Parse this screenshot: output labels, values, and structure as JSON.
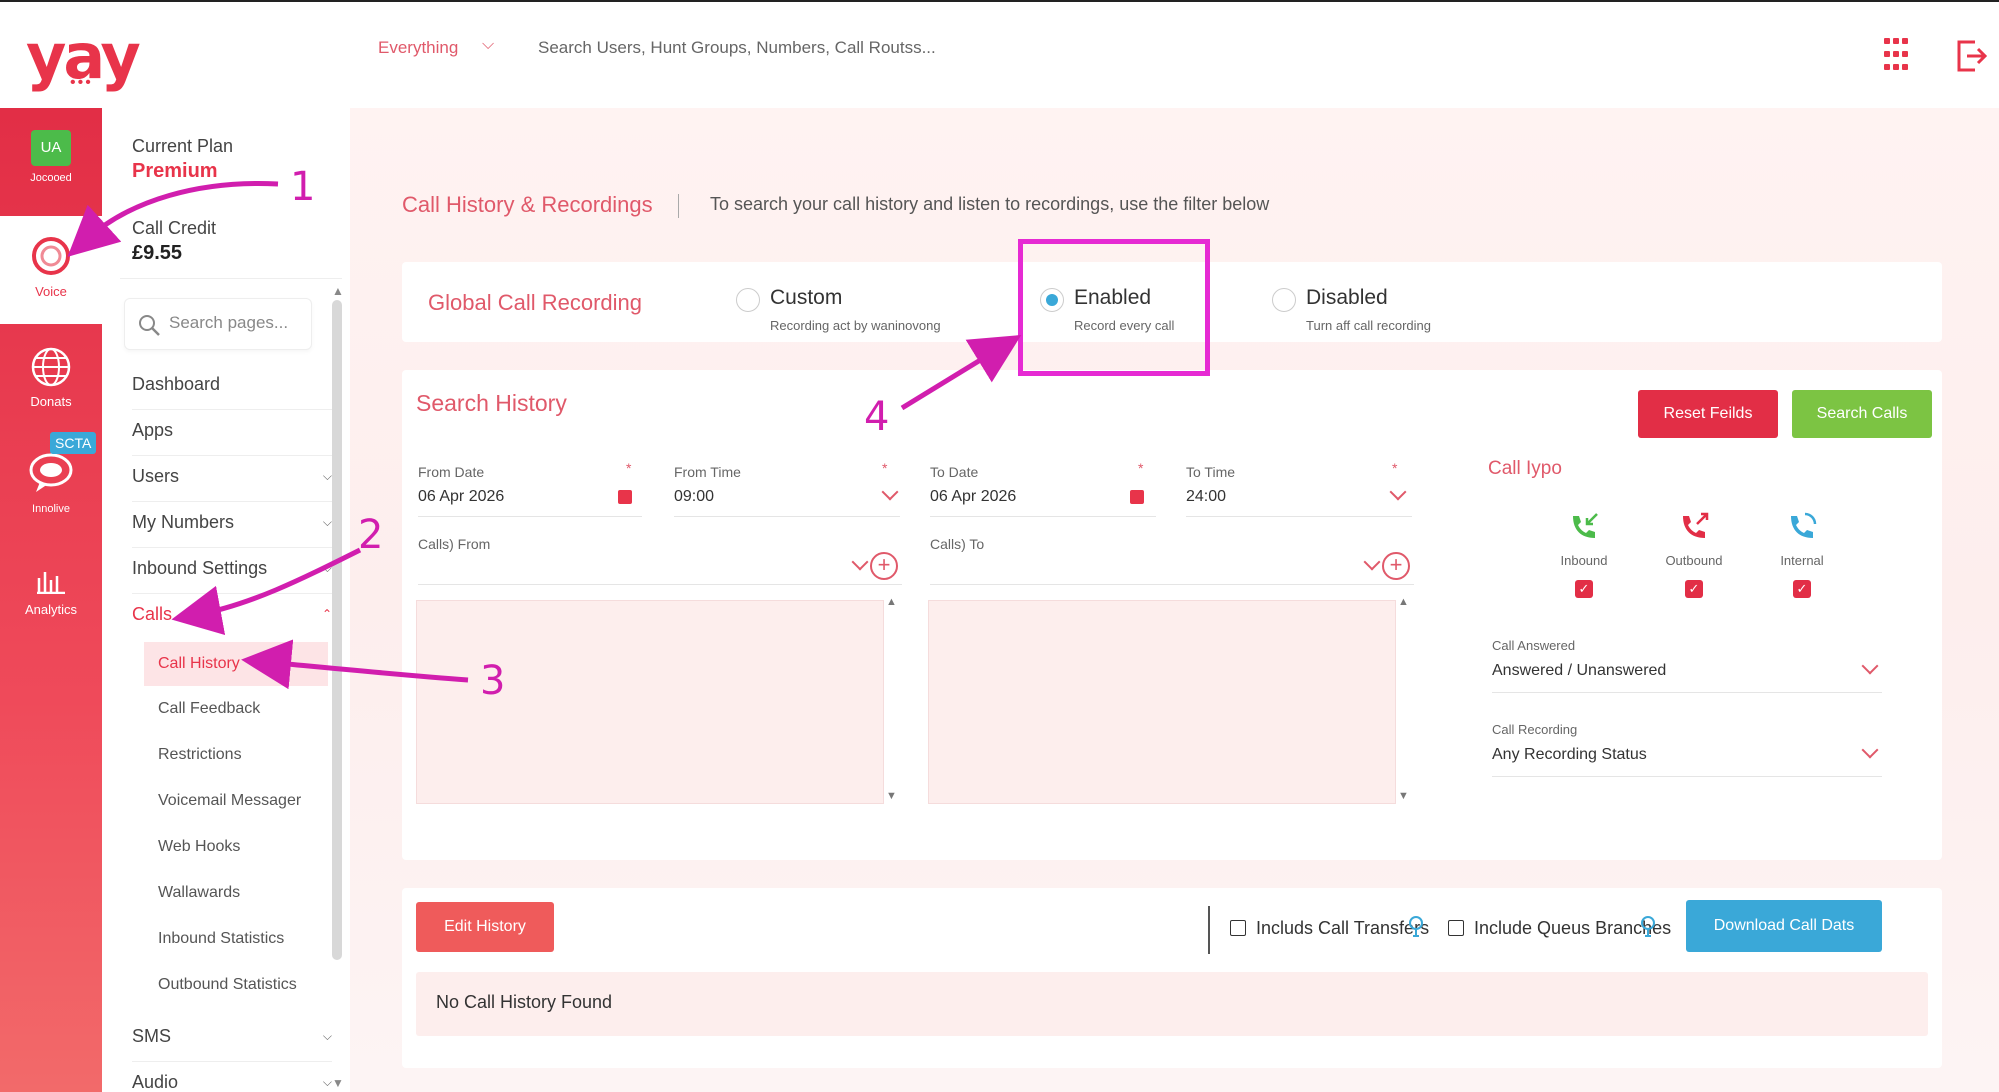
{
  "topbar": {
    "logo": "yay",
    "logo_dots": "•••",
    "scope_select": "Everything",
    "search_placeholder": "Search Users, Hunt Groups, Numbers, Call Routss..."
  },
  "rail": {
    "avatar_initials": "UA",
    "avatar_caption": "Jocooed",
    "voice_label": "Voice",
    "domains_label": "Donats",
    "inbox_label": "Innolive",
    "analytics_badge": "SCTA",
    "analytics_label": "Analytics"
  },
  "sidebar": {
    "plan_label": "Current Plan",
    "plan_value": "Premium",
    "credit_label": "Call Credit",
    "credit_value": "£9.55",
    "search_placeholder": "Search pages...",
    "nav": [
      {
        "label": "Dashboard"
      },
      {
        "label": "Apps"
      },
      {
        "label": "Users"
      },
      {
        "label": "My Numbers"
      },
      {
        "label": "Inbound Settings"
      },
      {
        "label": "Calls"
      }
    ],
    "calls_sub": [
      {
        "label": "Call History"
      },
      {
        "label": "Call Feedback"
      },
      {
        "label": "Restrictions"
      },
      {
        "label": "Voicemail Messager"
      },
      {
        "label": "Web Hooks"
      },
      {
        "label": "Wallawards"
      },
      {
        "label": "Inbound Statistics"
      },
      {
        "label": "Outbound Statistics"
      }
    ],
    "nav_bottom": [
      {
        "label": "SMS"
      },
      {
        "label": "Audio"
      }
    ]
  },
  "main": {
    "title": "Call History & Recordings",
    "description": "To search your call history and listen to recordings, use the filter below",
    "recording": {
      "label": "Global Call Recording",
      "options": [
        {
          "title": "Custom",
          "subtitle": "Recording act by waninovong",
          "selected": false
        },
        {
          "title": "Enabled",
          "subtitle": "Record every call",
          "selected": true
        },
        {
          "title": "Disabled",
          "subtitle": "Turn aff call recording",
          "selected": false
        }
      ]
    },
    "search": {
      "title": "Search History",
      "reset_label": "Reset Feilds",
      "search_label": "Search Calls",
      "from_date_label": "From Date",
      "from_date": "06 Apr 2026",
      "from_time_label": "From Time",
      "from_time": "09:00",
      "to_date_label": "To Date",
      "to_date": "06 Apr 2026",
      "to_time_label": "To Time",
      "to_time": "24:00",
      "required_mark": "*",
      "calls_from_label": "Calls) From",
      "calls_to_label": "Calls) To",
      "call_type_title": "Call Iypo",
      "call_types": [
        {
          "label": "Inbound",
          "checked": true,
          "icon": "inbound-call-icon"
        },
        {
          "label": "Outbound",
          "checked": true,
          "icon": "outbound-call-icon"
        },
        {
          "label": "Internal",
          "checked": true,
          "icon": "internal-call-icon"
        }
      ],
      "call_answered_label": "Call Answered",
      "call_answered_value": "Answered / Unanswered",
      "call_recording_label": "Call Recording",
      "call_recording_value": "Any Recording Status"
    },
    "results": {
      "edit_label": "Edit History",
      "include_transfers_label": "Includs Call Transfers",
      "include_queue_label": "Include Queus Branches",
      "download_label": "Download Call Dats",
      "empty_message": "No Call History Found"
    }
  },
  "annotations": {
    "numbers": [
      "1",
      "2",
      "3",
      "4"
    ],
    "color": "#d11eae"
  },
  "colors": {
    "brand": "#e8344a",
    "accent_blue": "#3aa8d8",
    "accent_green": "#7cc443",
    "annotation": "#e62ad3"
  }
}
